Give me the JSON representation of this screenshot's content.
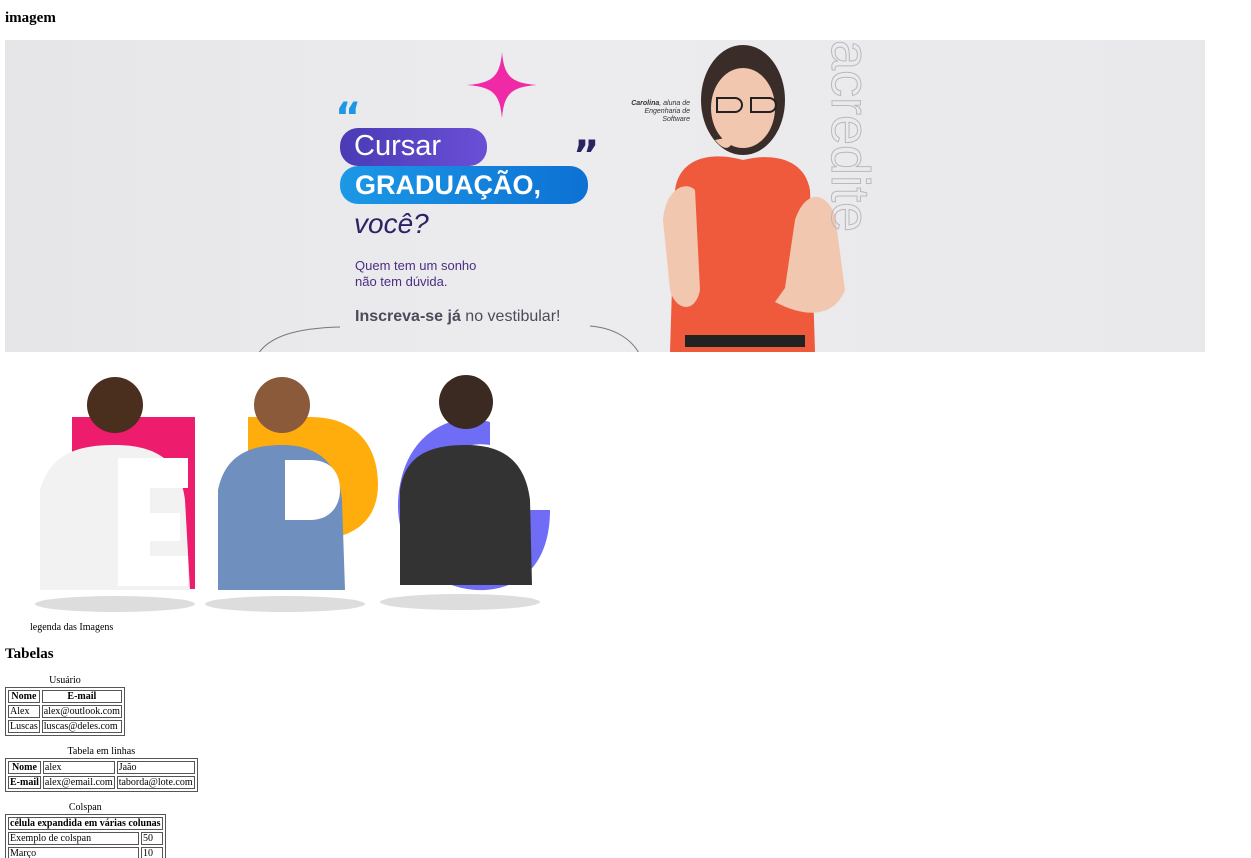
{
  "headings": {
    "imagem": "imagem",
    "tabelas": "Tabelas"
  },
  "banner": {
    "line1": "Cursar",
    "line2": "GRADUAÇÃO,",
    "line3": "você?",
    "sub1": "Quem tem um sonho",
    "sub2": "não tem dúvida.",
    "cta_bold": "Inscreva-se já",
    "cta_rest": " no vestibular!",
    "caption_name": "Carolina",
    "caption_rest": ", aluna de Engenharia de Software",
    "vertical_text": "acredite"
  },
  "figure": {
    "letters": [
      "E",
      "P",
      "G"
    ],
    "caption": "legenda das Imagens"
  },
  "colors": {
    "purple": "#4a3bb5",
    "blue": "#0d71d4",
    "pink": "#ee1c6c",
    "yellow": "#ffad0d",
    "violet": "#6f6cf6"
  },
  "table1": {
    "caption": "Usuário",
    "headers": [
      "Nome",
      "E-mail"
    ],
    "rows": [
      [
        "Alex",
        "alex@outlook.com"
      ],
      [
        "Luscas",
        "luscas@deles.com"
      ]
    ]
  },
  "table2": {
    "caption": "Tabela em linhas",
    "rows": [
      [
        "Nome",
        "alex",
        "Jaão"
      ],
      [
        "E-mail",
        "alex@email.com",
        "taborda@lote.com"
      ]
    ]
  },
  "table3": {
    "caption": "Colspan",
    "header": "célula expandida em várias colunas",
    "rows": [
      [
        "Exemplo de colspan",
        "50"
      ],
      [
        "Março",
        "10"
      ]
    ]
  }
}
